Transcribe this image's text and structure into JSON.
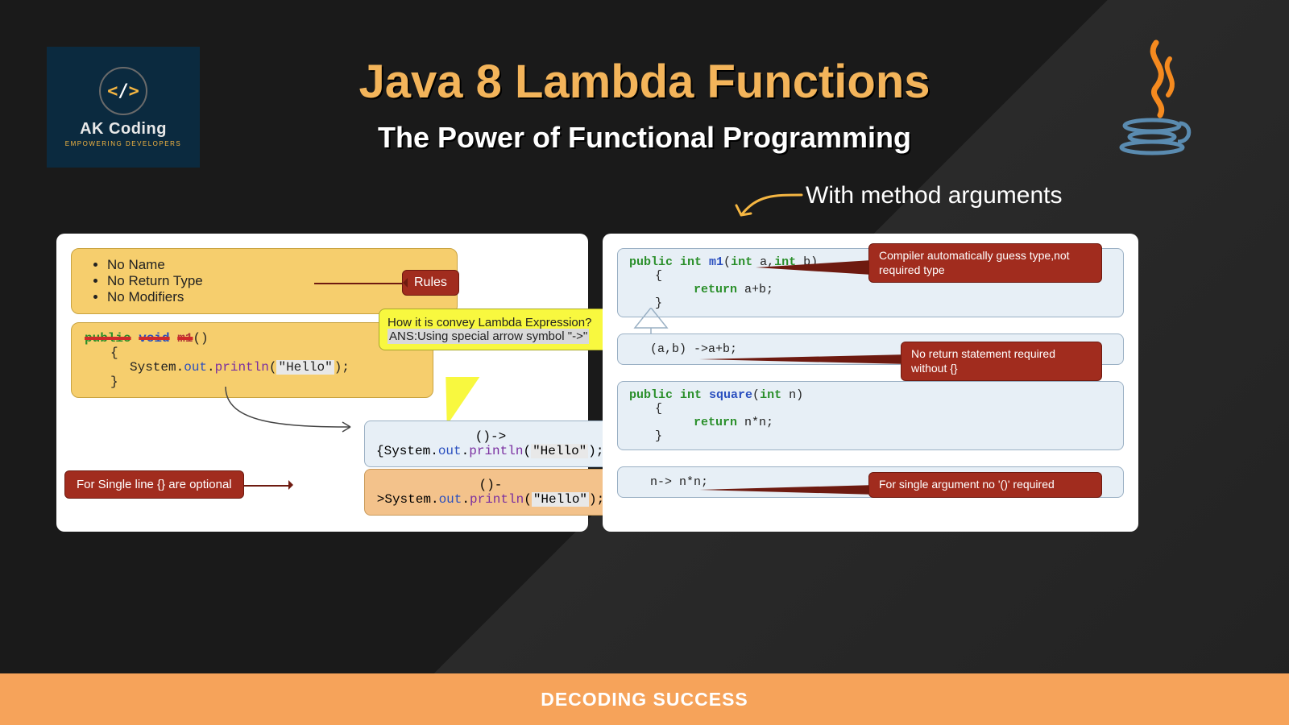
{
  "logo": {
    "mark_left": "<",
    "mark_slash": "/",
    "mark_right": ">",
    "title": "AK Coding",
    "subtitle": "EMPOWERING DEVELOPERS"
  },
  "heading": {
    "title": "Java 8 Lambda Functions",
    "subtitle": "The Power of Functional Programming",
    "section_label": "With method arguments"
  },
  "left_panel": {
    "rules": [
      "No Name",
      "No Return Type",
      "No Modifiers"
    ],
    "rules_tag": "Rules",
    "method_code": {
      "sig_public": "public",
      "sig_void": "void",
      "sig_name": "m1",
      "sig_paren": "()",
      "brace_open": "{",
      "stmt_prefix": "System.",
      "stmt_out": "out",
      "stmt_dot": ".",
      "stmt_println": "println",
      "stmt_open": "(",
      "stmt_str": "\"Hello\"",
      "stmt_close": ");",
      "brace_close": "}"
    },
    "q_box": {
      "q": "How it is convey Lambda Expression?",
      "a_label": "ANS:",
      "a_text": "Using special arrow symbol \"->\""
    },
    "lambda_blue": "()->{System.out.println(\"Hello\");}",
    "lambda_orange": "()->System.out.println(\"Hello\");",
    "single_line_tag": "For Single line {} are optional"
  },
  "right_panel": {
    "code1": {
      "line1_a": "public int ",
      "line1_b": "m1",
      "line1_c": "(",
      "line1_d": "int ",
      "line1_e": "a,",
      "line1_f": "int ",
      "line1_g": "b)",
      "brace_open": "{",
      "ret": "return ",
      "expr": "a+b;",
      "brace_close": "}"
    },
    "callout1": "Compiler automatically guess type,not required type",
    "code2": "(a,b) ->a+b;",
    "callout2": "No return statement required without {}",
    "code3": {
      "line1_a": "public int ",
      "line1_b": "square",
      "line1_c": "(",
      "line1_d": "int ",
      "line1_e": "n)",
      "brace_open": "{",
      "ret": "return ",
      "expr": "n*n;",
      "brace_close": "}"
    },
    "code4": "n-> n*n;",
    "callout3": "For single argument no '()' required"
  },
  "footer": "DECODING SUCCESS"
}
